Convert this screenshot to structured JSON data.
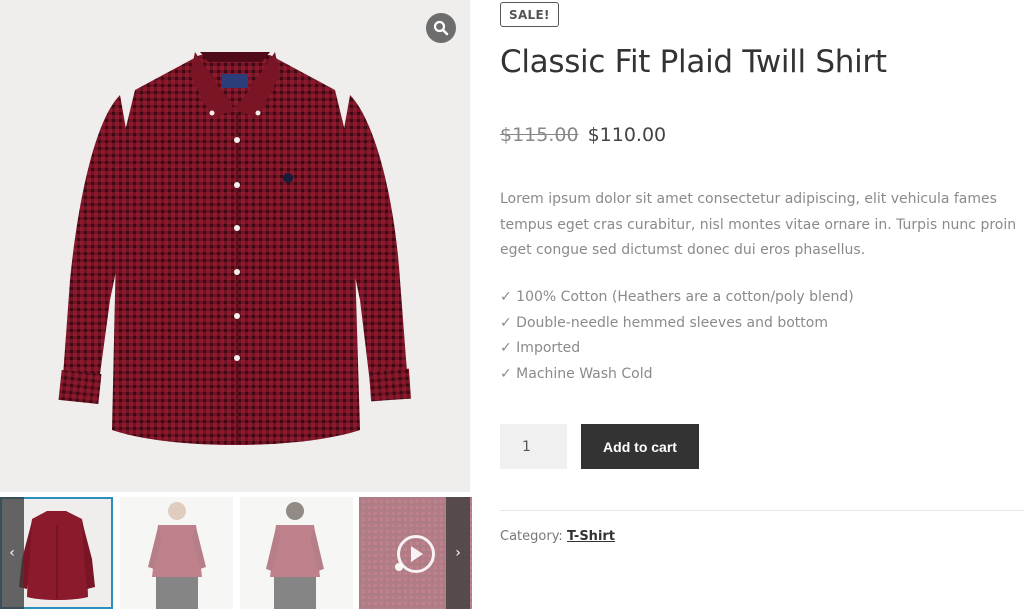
{
  "product": {
    "badge": "SALE!",
    "title": "Classic Fit Plaid Twill Shirt",
    "old_price": "$115.00",
    "new_price": "$110.00",
    "description": "Lorem ipsum dolor sit amet consectetur adipiscing, elit vehicula fames tempus eget cras curabitur, nisl montes vitae ornare in. Turpis nunc proin eget congue sed dictumst donec dui eros phasellus.",
    "features": [
      "✓ 100% Cotton (Heathers are a cotton/poly blend)",
      "✓ Double-needle hemmed sleeves and bottom",
      "✓ Imported",
      "✓ Machine Wash Cold"
    ],
    "quantity": "1",
    "add_to_cart": "Add to cart",
    "category_label": "Category:",
    "category": "T-Shirt"
  },
  "gallery": {
    "zoom_icon": "search-icon",
    "prev_icon": "chevron-left-icon",
    "next_icon": "chevron-right-icon",
    "prev_glyph": "‹",
    "next_glyph": "›",
    "video_icon": "play-icon"
  },
  "colors": {
    "shirt": "#8b1a2d",
    "shirt_dark": "#5e0f1d",
    "accent_border": "#2a8fbd",
    "button": "#333333"
  }
}
